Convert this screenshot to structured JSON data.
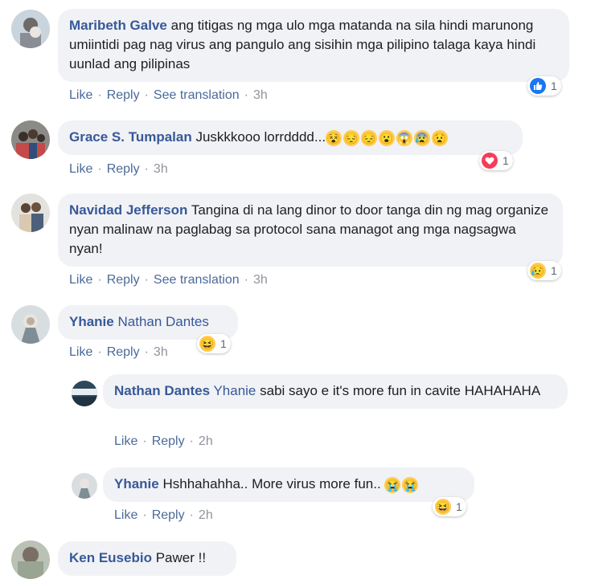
{
  "comments": [
    {
      "author": "Maribeth Galve",
      "text": "ang titigas ng mga ulo mga matanda na sila hindi marunong umiintidi pag nag virus ang pangulo ang sisihin mga pilipino talaga kaya hindi uunlad ang pilipinas",
      "actions": {
        "like": "Like",
        "reply": "Reply",
        "translate": "See translation",
        "time": "3h"
      },
      "reaction": {
        "type": "like-icon",
        "count": "1"
      }
    },
    {
      "author": "Grace S. Tumpalan",
      "text": "Juskkkooo lorrdddd...",
      "emojis": [
        "😵",
        "😔",
        "😔",
        "😮",
        "😱",
        "😰",
        "😧"
      ],
      "actions": {
        "like": "Like",
        "reply": "Reply",
        "time": "3h"
      },
      "reaction": {
        "type": "heart-icon",
        "count": "1"
      }
    },
    {
      "author": "Navidad Jefferson",
      "text": "Tangina di na lang dinor to door tanga din ng mag organize nyan malinaw na paglabag sa protocol sana managot ang mga nagsagwa nyan!",
      "actions": {
        "like": "Like",
        "reply": "Reply",
        "translate": "See translation",
        "time": "3h"
      },
      "reaction": {
        "type": "sad-icon",
        "count": "1"
      }
    },
    {
      "author": "Yhanie",
      "mention": "Nathan Dantes",
      "actions": {
        "like": "Like",
        "reply": "Reply",
        "time": "3h"
      },
      "reaction": {
        "type": "haha-icon",
        "count": "1"
      }
    },
    {
      "author": "Nathan Dantes",
      "mention": "Yhanie",
      "text": "sabi sayo e it's more fun in cavite HAHAHAHA",
      "actions": {
        "like": "Like",
        "reply": "Reply",
        "time": "2h"
      }
    },
    {
      "author": "Yhanie",
      "text": "Hshhahahha.. More virus more fun..",
      "emojis": [
        "😭",
        "😭"
      ],
      "actions": {
        "like": "Like",
        "reply": "Reply",
        "time": "2h"
      },
      "reaction": {
        "type": "haha-icon",
        "count": "1"
      }
    },
    {
      "author": "Ken Eusebio",
      "text": "Pawer !!"
    }
  ],
  "emoji_glyphs": {
    "haha": "😆",
    "sad": "😥"
  }
}
